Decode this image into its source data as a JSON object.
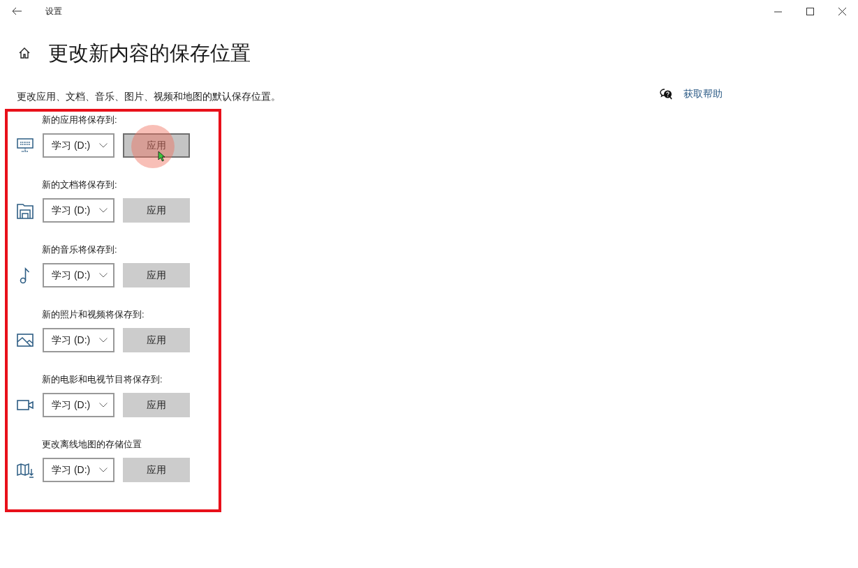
{
  "window": {
    "title": "设置"
  },
  "page": {
    "heading": "更改新内容的保存位置",
    "description": "更改应用、文档、音乐、图片、视频和地图的默认保存位置。"
  },
  "help_link": {
    "label": "获取帮助"
  },
  "locations": [
    {
      "kind": "apps",
      "label": "新的应用将保存到:",
      "drive": "学习 (D:)",
      "button": "应用",
      "hovered": true
    },
    {
      "kind": "documents",
      "label": "新的文档将保存到:",
      "drive": "学习 (D:)",
      "button": "应用",
      "hovered": false
    },
    {
      "kind": "music",
      "label": "新的音乐将保存到:",
      "drive": "学习 (D:)",
      "button": "应用",
      "hovered": false
    },
    {
      "kind": "photos",
      "label": "新的照片和视频将保存到:",
      "drive": "学习 (D:)",
      "button": "应用",
      "hovered": false
    },
    {
      "kind": "videos",
      "label": "新的电影和电视节目将保存到:",
      "drive": "学习 (D:)",
      "button": "应用",
      "hovered": false
    },
    {
      "kind": "maps",
      "label": "更改离线地图的存储位置",
      "drive": "学习 (D:)",
      "button": "应用",
      "hovered": false
    }
  ],
  "annotation": {
    "highlight_frame": true
  }
}
